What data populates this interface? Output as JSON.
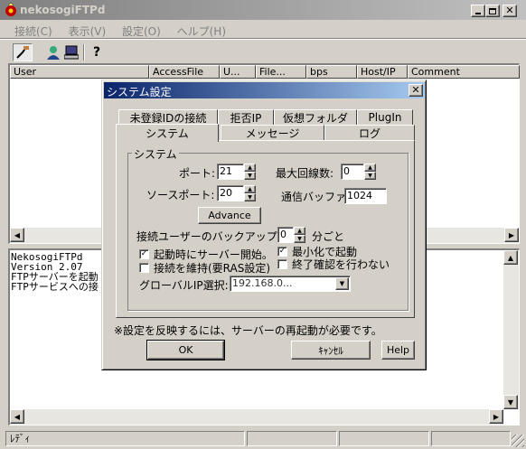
{
  "window": {
    "title": "nekosogiFTPd"
  },
  "menu": [
    "接続(C)",
    "表示(V)",
    "設定(O)",
    "ヘルプ(H)"
  ],
  "toolbar": {
    "icons": [
      "connect-icon",
      "user-icon",
      "computer-icon",
      "help-icon"
    ]
  },
  "columns": [
    "User",
    "AccessFile",
    "U...",
    "File...",
    "bps",
    "Host/IP",
    "Comment"
  ],
  "log": [
    "NekosogiFTPd",
    "Version  2.07",
    "FTPサーバーを起動",
    "FTPサービスへの接"
  ],
  "status": {
    "text": "ﾚﾃﾞｨ"
  },
  "dialog": {
    "title": "システム設定",
    "tabs_back": [
      "未登録IDの接続",
      "拒否IP",
      "仮想フォルダ",
      "PlugIn"
    ],
    "tabs_front": [
      "システム",
      "メッセージ",
      "ログ"
    ],
    "group_title": "システム",
    "port_label": "ポート:",
    "port_value": "21",
    "source_port_label": "ソースポート:",
    "source_port_value": "20",
    "max_lines_label": "最大回線数:",
    "max_lines_value": "0",
    "buffer_label": "通信バッファ:",
    "buffer_value": "1024",
    "advance_label": "Advance",
    "backup_label": "接続ユーザーのバックアップ",
    "backup_value": "0",
    "backup_unit": "分ごと",
    "chk_start": {
      "label": "起動時にサーバー開始。",
      "checked": true
    },
    "chk_minimize": {
      "label": "最小化で起動",
      "checked": true
    },
    "chk_keep": {
      "label": "接続を維持(要RAS設定)",
      "checked": false
    },
    "chk_exit": {
      "label": "終了確認を行わない",
      "checked": false
    },
    "global_ip_label": "グローバルIP選択:",
    "global_ip_value": "192.168.0...",
    "note": "※設定を反映するには、サーバーの再起動が必要です。",
    "ok": "OK",
    "cancel": "ｷｬﾝｾﾙ",
    "help": "Help"
  }
}
